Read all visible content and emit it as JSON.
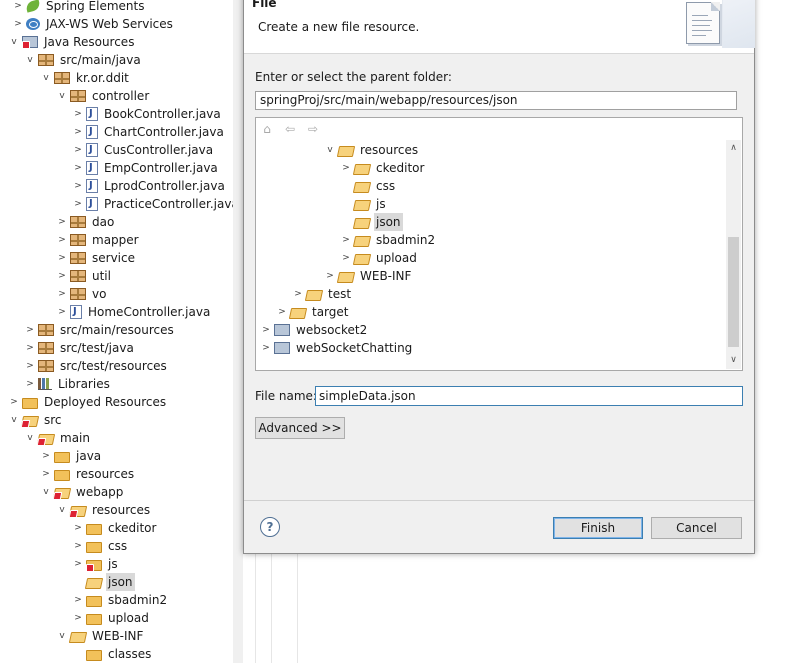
{
  "explorer": {
    "items": [
      {
        "label": "Spring Elements",
        "icon": "spring-leaf-icon"
      },
      {
        "label": "JAX-WS Web Services",
        "icon": "web-services-icon"
      },
      {
        "label": "Java Resources",
        "icon": "java-resources-icon"
      },
      {
        "label": "src/main/java",
        "icon": "source-folder-icon"
      },
      {
        "label": "kr.or.ddit",
        "icon": "package-icon"
      },
      {
        "label": "controller",
        "icon": "package-icon"
      },
      {
        "label": "BookController.java",
        "icon": "java-file-icon"
      },
      {
        "label": "ChartController.java",
        "icon": "java-file-icon"
      },
      {
        "label": "CusController.java",
        "icon": "java-file-icon"
      },
      {
        "label": "EmpController.java",
        "icon": "java-file-icon"
      },
      {
        "label": "LprodController.java",
        "icon": "java-file-icon"
      },
      {
        "label": "PracticeController.java",
        "icon": "java-file-icon"
      },
      {
        "label": "dao",
        "icon": "package-icon"
      },
      {
        "label": "mapper",
        "icon": "package-icon"
      },
      {
        "label": "service",
        "icon": "package-icon"
      },
      {
        "label": "util",
        "icon": "package-icon"
      },
      {
        "label": "vo",
        "icon": "package-icon"
      },
      {
        "label": "HomeController.java",
        "icon": "java-file-icon"
      },
      {
        "label": "src/main/resources",
        "icon": "source-folder-icon"
      },
      {
        "label": "src/test/java",
        "icon": "source-folder-icon"
      },
      {
        "label": "src/test/resources",
        "icon": "source-folder-icon"
      },
      {
        "label": "Libraries",
        "icon": "libraries-icon"
      },
      {
        "label": "Deployed Resources",
        "icon": "folder-icon"
      },
      {
        "label": "src",
        "icon": "folder-error-icon"
      },
      {
        "label": "main",
        "icon": "folder-error-icon"
      },
      {
        "label": "java",
        "icon": "folder-icon"
      },
      {
        "label": "resources",
        "icon": "folder-icon"
      },
      {
        "label": "webapp",
        "icon": "folder-error-icon"
      },
      {
        "label": "resources",
        "icon": "folder-error-icon"
      },
      {
        "label": "ckeditor",
        "icon": "folder-icon"
      },
      {
        "label": "css",
        "icon": "folder-icon"
      },
      {
        "label": "js",
        "icon": "folder-error-icon"
      },
      {
        "label": "json",
        "icon": "folder-icon"
      },
      {
        "label": "sbadmin2",
        "icon": "folder-icon"
      },
      {
        "label": "upload",
        "icon": "folder-icon"
      },
      {
        "label": "WEB-INF",
        "icon": "folder-icon"
      },
      {
        "label": "classes",
        "icon": "folder-icon"
      }
    ]
  },
  "dialog": {
    "title": "File",
    "description": "Create a new file resource.",
    "parent_label": "Enter or select the parent folder:",
    "parent_value": "springProj/src/main/webapp/resources/json",
    "tree_items": [
      {
        "label": "resources",
        "icon": "folder-icon"
      },
      {
        "label": "ckeditor",
        "icon": "folder-icon"
      },
      {
        "label": "css",
        "icon": "folder-icon"
      },
      {
        "label": "js",
        "icon": "folder-icon"
      },
      {
        "label": "json",
        "icon": "folder-icon"
      },
      {
        "label": "sbadmin2",
        "icon": "folder-icon"
      },
      {
        "label": "upload",
        "icon": "folder-icon"
      },
      {
        "label": "WEB-INF",
        "icon": "folder-icon"
      },
      {
        "label": "test",
        "icon": "folder-icon"
      },
      {
        "label": "target",
        "icon": "folder-icon"
      },
      {
        "label": "websocket2",
        "icon": "maven-project-icon"
      },
      {
        "label": "webSocketChatting",
        "icon": "maven-project-icon"
      }
    ],
    "file_name_label": "File name:",
    "file_name_value": "simpleData.json",
    "advanced_label": "Advanced >>",
    "finish_label": "Finish",
    "cancel_label": "Cancel"
  }
}
